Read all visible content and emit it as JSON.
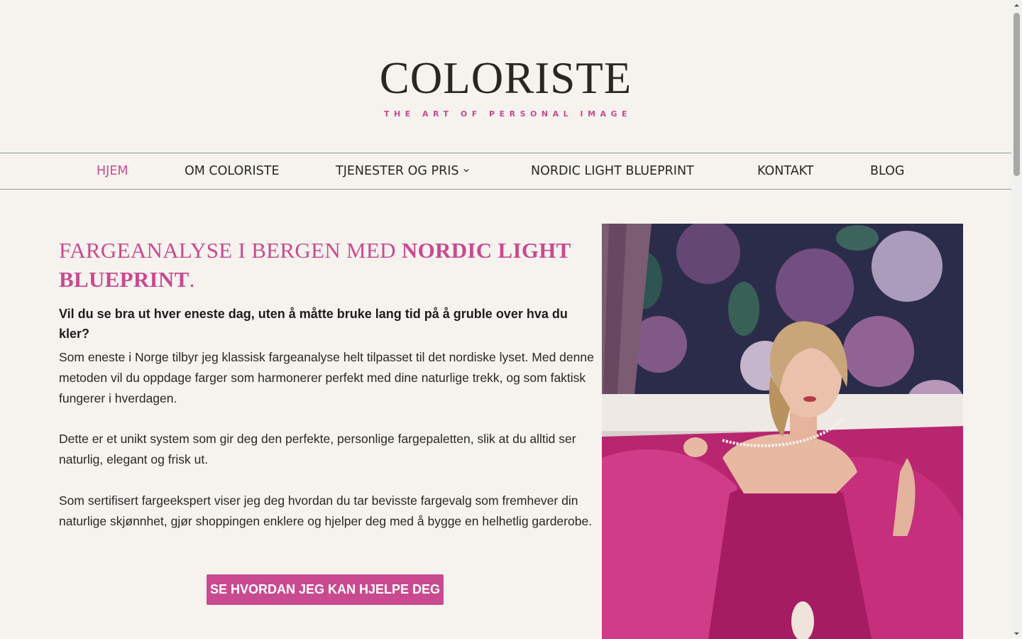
{
  "brand": {
    "name": "COLORISTE",
    "tagline": "THE ART OF PERSONAL IMAGE",
    "accent_color": "#c94a8f"
  },
  "nav": {
    "items": [
      {
        "label": "HJEM",
        "active": true
      },
      {
        "label": "OM COLORISTE"
      },
      {
        "label": "TJENESTER OG PRIS",
        "has_dropdown": true
      },
      {
        "label": "NORDIC LIGHT BLUEPRINT"
      },
      {
        "label": "KONTAKT"
      },
      {
        "label": "BLOG"
      }
    ],
    "dropdown_icon": "chevron-down-icon"
  },
  "hero": {
    "headline_light": "FARGEANALYSE I BERGEN MED ",
    "headline_bold": "NORDIC LIGHT BLUEPRINT",
    "headline_end": ".",
    "lead": "Vil du se bra ut hver eneste dag, uten å måtte bruke lang tid på å gruble over hva du kler?",
    "paragraphs": [
      "Som eneste i Norge tilbyr jeg klassisk fargeanalyse helt tilpasset til det nordiske lyset. Med denne metoden vil du oppdage farger som harmonerer perfekt med dine naturlige trekk, og som faktisk fungerer i hverdagen.",
      "Dette er et unikt system som gir deg den perfekte, personlige fargepaletten, slik at du alltid ser naturlig, elegant og frisk ut.",
      "Som sertifisert fargeekspert viser jeg deg hvordan du tar bevisste fargevalg som fremhever din naturlige skjønnhet, gjør shoppingen enklere og hjelper deg med å bygge en helhetlig garderobe."
    ],
    "cta_label": "SE HVORDAN JEG KAN HJELPE DEG"
  }
}
